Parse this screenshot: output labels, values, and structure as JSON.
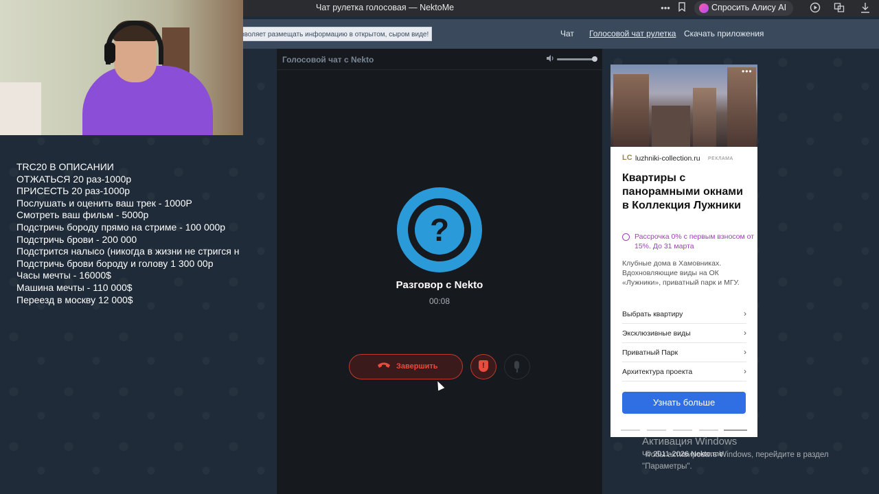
{
  "browser": {
    "title": "Чат рулетка голосовая — NektoMe",
    "alice_label": "Спросить Алису AI"
  },
  "header": {
    "notice": "зволяет размещать информацию в открытом, сыром виде!",
    "nav": [
      {
        "label": "Чат",
        "active": false
      },
      {
        "label": "Голосовой чат рулетка",
        "active": true
      },
      {
        "label": "Скачать приложения",
        "active": false
      }
    ]
  },
  "overlay": {
    "lines": [
      "TRC20 В ОПИСАНИИ",
      "ОТЖАТЬСЯ 20 раз-1000р",
      "ПРИСЕСТЬ 20 раз-1000р",
      "Послушать и оценить ваш трек - 1000Р",
      "Смотреть ваш фильм - 5000р",
      "Подстричь бороду прямо на стриме - 100 000р",
      "Подстричь брови - 200 000",
      "Подстрится налысо (никогда в жизни не стригся н",
      "Подстричь брови бороду и голову 1 300 00р",
      "Часы мечты - 16000$",
      "Машина мечты - 110 000$",
      "Переезд в москву 12 000$"
    ]
  },
  "chat": {
    "title": "Голосовой чат с Nekto",
    "volume_level": 0.95,
    "avatar_symbol": "?",
    "conversation_name": "Разговор с Nekto",
    "timer": "00:08",
    "end_label": "Завершить",
    "shield_symbol": "!"
  },
  "ad": {
    "logo": "LC",
    "domain": "luzhniki-collection.ru",
    "tag": "РЕКЛАМА",
    "menu": "•••",
    "headline": "Квартиры с панорамными окнами в Коллекция Лужники",
    "promo": "Рассрочка 0% с первым взносом от 15%. До 31 марта",
    "body": "Клубные дома в Хамовниках. Вдохновляющие виды на ОК «Лужники», приватный парк и МГУ.",
    "links": [
      "Выбрать квартиру",
      "Эксклюзивные виды",
      "Приватный Парк",
      "Архитектура проекта"
    ],
    "cta": "Узнать больше"
  },
  "windows": {
    "title": "Активация Windows",
    "subtitle": "Чтобы активировать Windows, перейдите в раздел \"Параметры\".",
    "copyright": "© 2011-2026 Nekto.me"
  },
  "colors": {
    "page_bg": "#1f2b38",
    "header_bg": "#3a4a5c",
    "accent_blue": "#2b9ad8",
    "danger_red": "#e74c3c",
    "cta_blue": "#2f6fe3"
  }
}
